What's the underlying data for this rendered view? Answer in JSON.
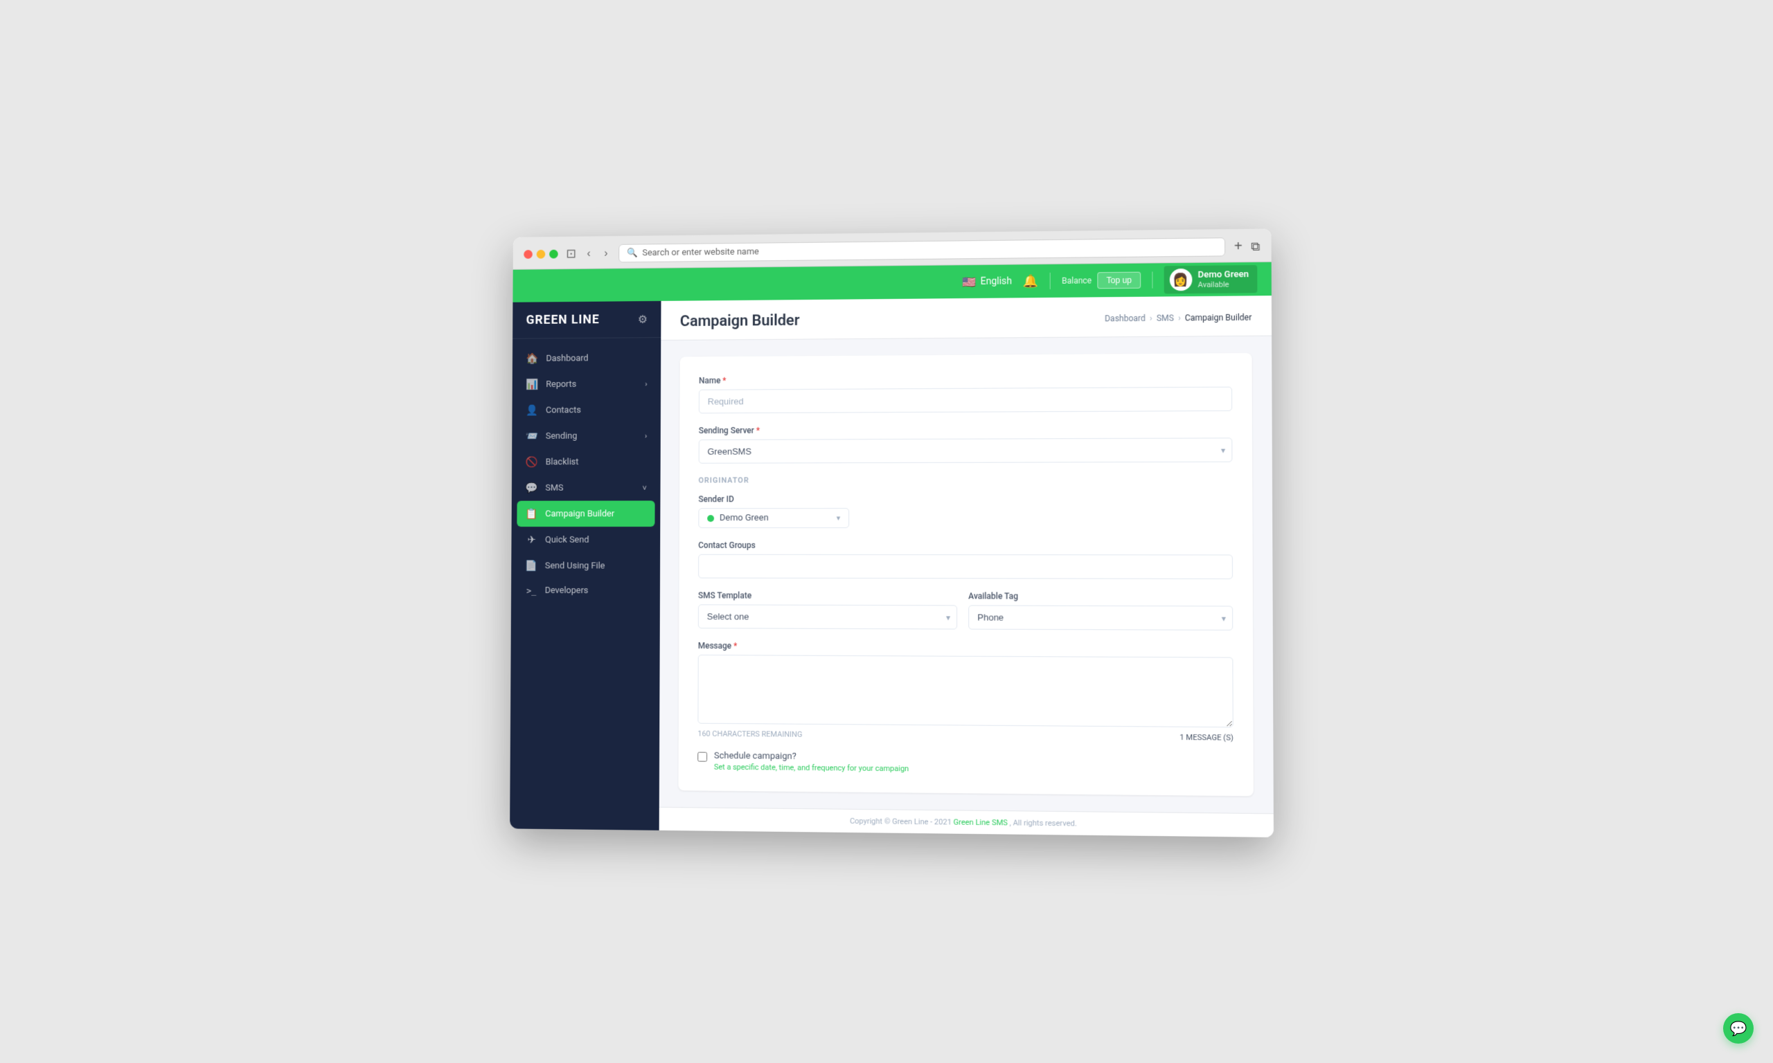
{
  "browser": {
    "address_placeholder": "Search or enter website name",
    "new_tab_icon": "+",
    "window_icon": "⧉"
  },
  "header": {
    "language": "English",
    "flag": "🇺🇸",
    "balance_label": "Balance",
    "topup_label": "Top up",
    "user_name": "Demo Green",
    "user_status": "Available",
    "user_emoji": "👩"
  },
  "sidebar": {
    "logo": "GREEN LINE",
    "items": [
      {
        "id": "dashboard",
        "label": "Dashboard",
        "icon": "🏠",
        "has_arrow": false,
        "active": false
      },
      {
        "id": "reports",
        "label": "Reports",
        "icon": "📊",
        "has_arrow": true,
        "active": false
      },
      {
        "id": "contacts",
        "label": "Contacts",
        "icon": "👤",
        "has_arrow": false,
        "active": false
      },
      {
        "id": "sending",
        "label": "Sending",
        "icon": "📨",
        "has_arrow": true,
        "active": false
      },
      {
        "id": "blacklist",
        "label": "Blacklist",
        "icon": "🚫",
        "has_arrow": false,
        "active": false
      },
      {
        "id": "sms",
        "label": "SMS",
        "icon": "💬",
        "has_arrow": true,
        "active": false
      },
      {
        "id": "campaign-builder",
        "label": "Campaign Builder",
        "icon": "📋",
        "has_arrow": false,
        "active": true
      },
      {
        "id": "quick-send",
        "label": "Quick Send",
        "icon": "✈",
        "has_arrow": false,
        "active": false
      },
      {
        "id": "send-using-file",
        "label": "Send Using File",
        "icon": "📄",
        "has_arrow": false,
        "active": false
      },
      {
        "id": "developers",
        "label": "Developers",
        "icon": ">_",
        "has_arrow": false,
        "active": false
      }
    ]
  },
  "page": {
    "title": "Campaign Builder",
    "breadcrumb": [
      {
        "label": "Dashboard",
        "active": false
      },
      {
        "label": "SMS",
        "active": false
      },
      {
        "label": "Campaign Builder",
        "active": true
      }
    ]
  },
  "form": {
    "name_label": "Name",
    "name_placeholder": "Required",
    "sending_server_label": "Sending Server",
    "sending_server_value": "GreenSMS",
    "originator_label": "ORIGINATOR",
    "sender_id_label": "Sender ID",
    "sender_id_value": "Demo Green",
    "contact_groups_label": "Contact Groups",
    "sms_template_label": "SMS Template",
    "sms_template_placeholder": "Select one",
    "available_tag_label": "Available Tag",
    "available_tag_value": "Phone",
    "message_label": "Message",
    "char_remaining": "160 CHARACTERS REMAINING",
    "msg_count": "1 MESSAGE (S)",
    "schedule_label": "Schedule campaign?",
    "schedule_hint": "Set a specific date, time, and frequency for your campaign"
  },
  "footer": {
    "text": "Copyright © Green Line - 2021",
    "link_text": "Green Line SMS",
    "text_suffix": ", All rights reserved."
  }
}
